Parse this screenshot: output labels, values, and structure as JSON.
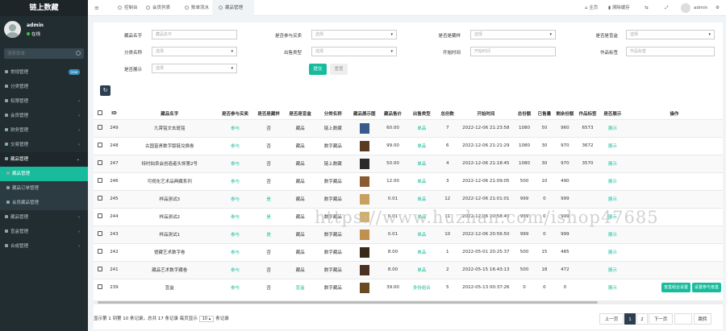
{
  "app": {
    "title": "链上数藏"
  },
  "user": {
    "name": "admin",
    "status": "在线"
  },
  "search": {
    "placeholder": "搜索菜单"
  },
  "sidebar": {
    "items": [
      {
        "label": "常规管理",
        "badge": "new"
      },
      {
        "label": "分类管理"
      },
      {
        "label": "权限管理"
      },
      {
        "label": "会员管理"
      },
      {
        "label": "财务管理"
      },
      {
        "label": "交易管理"
      },
      {
        "label": "藏品管理"
      }
    ],
    "submenu": [
      {
        "label": "藏品管理"
      },
      {
        "label": "藏品订单管理"
      },
      {
        "label": "会员藏品管理"
      }
    ],
    "items_after": [
      {
        "label": "藏品管理"
      },
      {
        "label": "盲盒管理"
      },
      {
        "label": "合成管理"
      }
    ]
  },
  "tabs": [
    "控制台",
    "会员列表",
    "账单流水",
    "藏品管理"
  ],
  "topright": {
    "home": "主页",
    "clear": "清除缓存",
    "user": "admin"
  },
  "filters": {
    "labels": [
      "藏品名字",
      "是否参与买卖",
      "是否是藏样",
      "是否是盲盒",
      "分类名称",
      "出售类型",
      "开始时间",
      "作品标签",
      "是否展示"
    ],
    "placeholders": [
      "藏品名字",
      "选择",
      "选择",
      "选择",
      "选择",
      "选择",
      "开始时间",
      "作品标签",
      "选择"
    ],
    "submit": "提交",
    "reset": "重置"
  },
  "table": {
    "headers": [
      "ID",
      "藏品名字",
      "是否参与买卖",
      "是否是藏样",
      "是否是盲盒",
      "分类名称",
      "藏品展示图",
      "藏品售价",
      "出售类型",
      "总份数",
      "开始时间",
      "总份额",
      "已售量",
      "剩余份额",
      "作品标签",
      "是否展示",
      "操作"
    ],
    "rows": [
      {
        "id": "249",
        "name": "九霄铭文玄斑铭",
        "buy": "参与",
        "sample": "否",
        "blind": "藏品",
        "cat": "链上数藏",
        "price": "60.00",
        "type": "单品",
        "total": "7",
        "time": "2022-12-06 21:23:58",
        "shares": "1080",
        "sold": "50",
        "left": "960",
        "tag": "6573",
        "show": "展示",
        "thumb": "#3a5a8c"
      },
      {
        "id": "248",
        "name": "古国富贵数字版链兑换卷",
        "buy": "参与",
        "sample": "否",
        "blind": "藏品",
        "cat": "数字藏品",
        "price": "99.00",
        "type": "单品",
        "total": "6",
        "time": "2022-12-06 21:21:29",
        "shares": "1080",
        "sold": "30",
        "left": "970",
        "tag": "3672",
        "show": "展示",
        "thumb": "#5a3a20"
      },
      {
        "id": "247",
        "name": "特时拍卖会创造者头饰第2号",
        "buy": "参与",
        "sample": "否",
        "blind": "藏品",
        "cat": "链上数藏",
        "price": "50.00",
        "type": "单品",
        "total": "4",
        "time": "2022-12-06 21:18:45",
        "shares": "1080",
        "sold": "30",
        "left": "970",
        "tag": "3570",
        "show": "展示",
        "thumb": "#2a2a2a"
      },
      {
        "id": "246",
        "name": "可视化艺术品典藏系列",
        "buy": "参与",
        "sample": "否",
        "blind": "藏品",
        "cat": "数字藏品",
        "price": "12.00",
        "type": "单品",
        "total": "3",
        "time": "2022-12-06 21:09:05",
        "shares": "500",
        "sold": "10",
        "left": "490",
        "tag": "",
        "show": "展示",
        "thumb": "#8a5a30"
      },
      {
        "id": "245",
        "name": "样品测试3",
        "buy": "参与",
        "sample": "是",
        "blind": "藏品",
        "cat": "数字藏品",
        "price": "0.01",
        "type": "单品",
        "total": "12",
        "time": "2022-12-06 21:01:01",
        "shares": "999",
        "sold": "0",
        "left": "999",
        "tag": "",
        "show": "展示",
        "thumb": "#c8a060"
      },
      {
        "id": "244",
        "name": "样品测试2",
        "buy": "参与",
        "sample": "是",
        "blind": "藏品",
        "cat": "数字藏品",
        "price": "0.01",
        "type": "单品",
        "total": "11",
        "time": "2022-12-06 20:58:49",
        "shares": "999",
        "sold": "0",
        "left": "999",
        "tag": "",
        "show": "展示",
        "thumb": "#d0b070"
      },
      {
        "id": "243",
        "name": "样品测试1",
        "buy": "参与",
        "sample": "是",
        "blind": "藏品",
        "cat": "数字藏品",
        "price": "0.01",
        "type": "单品",
        "total": "10",
        "time": "2022-12-06 20:56:50",
        "shares": "999",
        "sold": "0",
        "left": "999",
        "tag": "",
        "show": "展示",
        "thumb": "#c09050"
      },
      {
        "id": "242",
        "name": "馆藏艺术数字卷",
        "buy": "参与",
        "sample": "否",
        "blind": "藏品",
        "cat": "数字藏品",
        "price": "8.00",
        "type": "单品",
        "total": "1",
        "time": "2022-05-01 20:25:37",
        "shares": "500",
        "sold": "15",
        "left": "485",
        "tag": "",
        "show": "展示",
        "thumb": "#3a2a1a"
      },
      {
        "id": "241",
        "name": "藏品艺术数字藏卷",
        "buy": "参与",
        "sample": "否",
        "blind": "藏品",
        "cat": "数字藏品",
        "price": "8.00",
        "type": "单品",
        "total": "2",
        "time": "2022-05-15 16:43:13",
        "shares": "500",
        "sold": "18",
        "left": "472",
        "tag": "",
        "show": "展示",
        "thumb": "#4a3020"
      },
      {
        "id": "239",
        "name": "盲盒",
        "buy": "参与",
        "sample": "否",
        "blind": "盲盒",
        "cat": "数字藏品",
        "price": "39.00",
        "type": "多份组合",
        "total": "5",
        "time": "2022-05-13 00:37:26",
        "shares": "0",
        "sold": "0",
        "left": "0",
        "tag": "",
        "show": "展示",
        "thumb": "#6a4a20",
        "actions": [
          "盲盒组合设置",
          "设置参与盲盒"
        ]
      }
    ]
  },
  "footer": {
    "summary_prefix": "显示第 1 到第 10 条记录，总共 17 条记录 每页显示",
    "per_page": "10",
    "summary_suffix": "条记录",
    "prev": "上一页",
    "page1": "1",
    "page2": "2",
    "next": "下一页",
    "jump": "跳转"
  },
  "watermark": "https://www.huzhan.com/ishop47685"
}
